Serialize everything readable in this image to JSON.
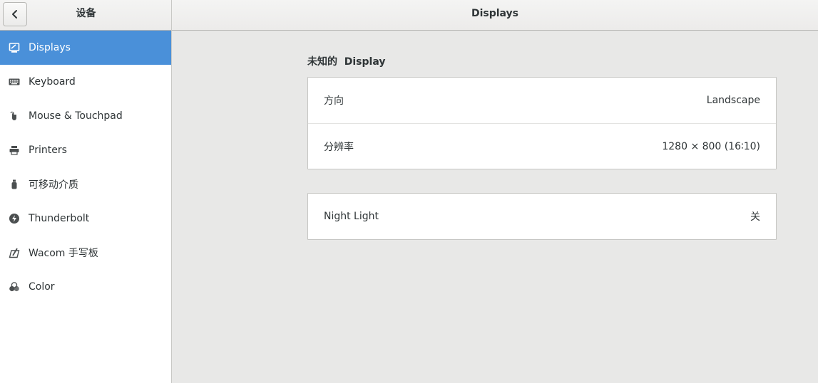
{
  "header": {
    "left_title": "设备",
    "right_title": "Displays"
  },
  "sidebar": {
    "items": [
      {
        "label": "Displays",
        "icon": "display-icon"
      },
      {
        "label": "Keyboard",
        "icon": "keyboard-icon"
      },
      {
        "label": "Mouse & Touchpad",
        "icon": "mouse-icon"
      },
      {
        "label": "Printers",
        "icon": "printer-icon"
      },
      {
        "label": "可移动介质",
        "icon": "usb-drive-icon"
      },
      {
        "label": "Thunderbolt",
        "icon": "thunderbolt-icon"
      },
      {
        "label": "Wacom 手写板",
        "icon": "tablet-icon"
      },
      {
        "label": "Color",
        "icon": "color-icon"
      }
    ],
    "selected": "Displays"
  },
  "main": {
    "section_title": "未知的  Display",
    "display_card": {
      "orientation_label": "方向",
      "orientation_value": "Landscape",
      "resolution_label": "分辨率",
      "resolution_value": "1280 × 800 (16∶10)"
    },
    "night_light_card": {
      "label": "Night Light",
      "value": "关"
    }
  },
  "colors": {
    "accent": "#4a90d9",
    "background": "#e8e8e7",
    "sidebar": "#ffffff"
  }
}
